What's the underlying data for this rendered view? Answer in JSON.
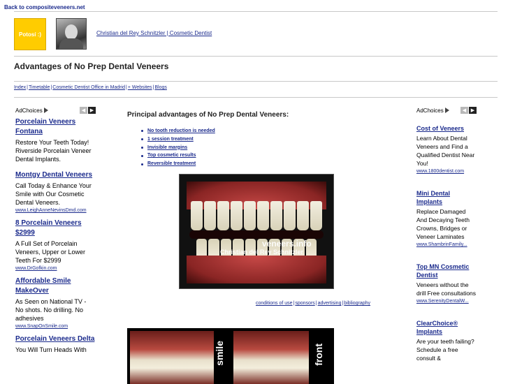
{
  "header": {
    "back_link": "Back to compositeveneers.net",
    "badge_text": "Potosí :)",
    "doctor_link": "Christian del Rey Schnitzler | Cosmetic Dentist"
  },
  "page_title": "Advantages of No Prep Dental Veneers",
  "nav": [
    "Index",
    "Timetable",
    "Cosmetic Dentist Office in Madrid",
    "+ Websites",
    "Blogs"
  ],
  "left_ads": {
    "label": "AdChoices",
    "items": [
      {
        "title": "Porcelain Veneers Fontana",
        "desc": "Restore Your Teeth Today! Riverside Porcelain Veneer Dental Implants.",
        "url": ""
      },
      {
        "title": "Montgy Dental Veneers",
        "desc": "Call Today & Enhance Your Smile with Our Cosmetic Dental Veneers.",
        "url": "www.LeighAnneNevinsDmd.com"
      },
      {
        "title": "8 Porcelain Veneers $2999",
        "desc": "A Full Set of Porcelain Veneers, Upper or Lower Teeth For $2999",
        "url": "www.DrGofkin.com"
      },
      {
        "title": "Affordable Smile MakeOver",
        "desc": "As Seen on National TV - No shots. No drilling. No adhesives",
        "url": "www.SnapOnSmile.com"
      },
      {
        "title": "Porcelain Veneers Delta",
        "desc": "You Will Turn Heads With",
        "url": ""
      }
    ]
  },
  "right_ads": {
    "label": "AdChoices",
    "items": [
      {
        "title": "Cost of Veneers",
        "desc": "Learn About Dental Veneers and Find a Qualified Dentist Near You!",
        "url": "www.1800dentist.com"
      },
      {
        "title": "Mini Dental Implants",
        "desc": "Replace Damaged And Decaying Teeth Crowns, Bridges or Veneer Laminates",
        "url": "www.ShambrinFamily..."
      },
      {
        "title": "Top MN Cosmetic Dentist",
        "desc": "Veneers without the drill Free consultations",
        "url": "www.SerenityDentalW..."
      },
      {
        "title": "ClearChoice® Implants",
        "desc": "Are your teeth failing? Schedule a free consult &",
        "url": ""
      }
    ]
  },
  "main": {
    "heading": "Principal advantages of No Prep Dental Veneers:",
    "bullets": [
      "No tooth reduction is needed",
      "1 session treatment",
      "Invisible margins",
      "Top cosmetic results",
      "Reversible treatment"
    ],
    "photo_watermark_1": "veneers.info",
    "photo_watermark_2": "Christian del Rey Schnitzler",
    "footer_links": [
      "conditions of use",
      "sponsors",
      "advertising",
      "bibliography"
    ],
    "strip_label_1": "smile",
    "strip_label_2": "front"
  },
  "colors": {
    "link": "#1a2a8c",
    "badge": "#ffcc00",
    "rule": "#c8c8c8"
  }
}
